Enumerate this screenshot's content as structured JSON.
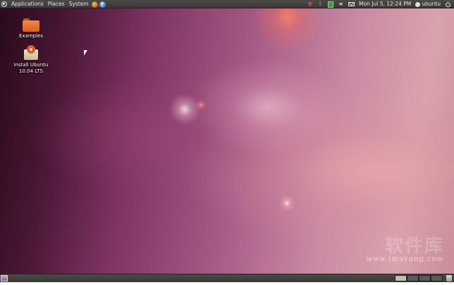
{
  "top_panel": {
    "menus": [
      "Applications",
      "Places",
      "System"
    ],
    "clock": "Mon Jul  5, 12:24 PM",
    "user": "ubuntu",
    "launchers": {
      "help_glyph": "?"
    },
    "tray_icons": [
      "network-icon",
      "bluetooth-icon",
      "battery-icon",
      "volume-icon",
      "mail-icon"
    ]
  },
  "desktop": {
    "icons": [
      {
        "name": "Examples",
        "icon": "folder-icon"
      },
      {
        "name": "Install Ubuntu 10.04 LTS",
        "icon": "installer-icon"
      }
    ]
  },
  "watermark": {
    "logo_text": "软件库",
    "url": "www.imuyang.com"
  },
  "bottom_panel": {
    "workspaces": 4,
    "active_workspace": 1
  },
  "colors": {
    "panel": "#3f3e3b",
    "wallpaper_dark": "#2a0a1c",
    "wallpaper_light": "#d9a3ad",
    "folder": "#e8772e"
  }
}
